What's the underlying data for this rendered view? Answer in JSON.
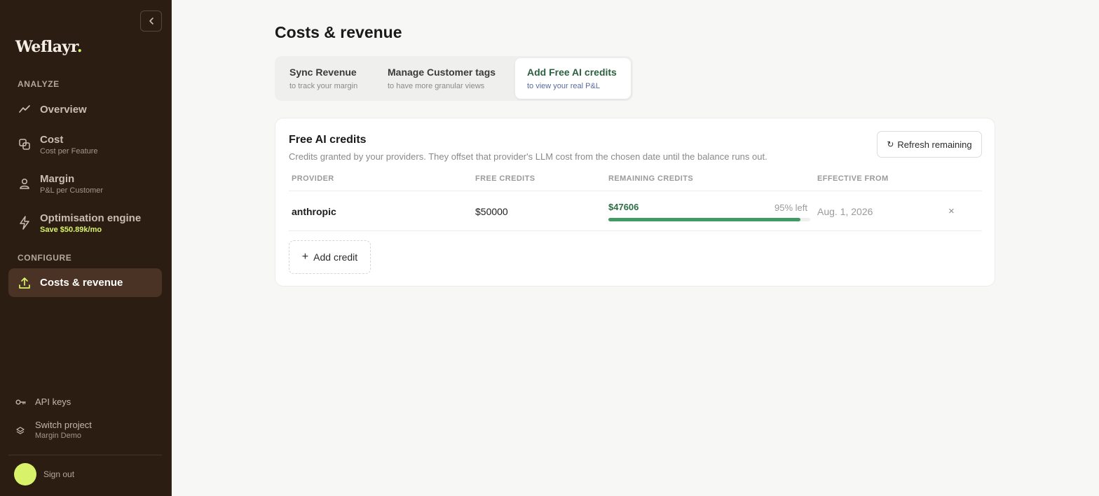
{
  "sidebar": {
    "logo_text": "Weflayr",
    "logo_dot": ".",
    "sections": {
      "analyze": "ANALYZE",
      "configure": "CONFIGURE"
    },
    "nav": {
      "overview": {
        "title": "Overview"
      },
      "cost": {
        "title": "Cost",
        "sub": "Cost per Feature"
      },
      "margin": {
        "title": "Margin",
        "sub": "P&L per Customer"
      },
      "optimisation": {
        "title": "Optimisation engine",
        "sub": "Save $50.89k/mo"
      },
      "costs_revenue": {
        "title": "Costs & revenue"
      }
    },
    "bottom": {
      "api_keys": "API keys",
      "switch_project": "Switch project",
      "project_name": "Margin Demo",
      "sign_out": "Sign out"
    },
    "colors": {
      "bg": "#2c1d12",
      "accent": "#d8f36a"
    }
  },
  "main": {
    "page_title": "Costs & revenue",
    "tabs": [
      {
        "title": "Sync Revenue",
        "sub": "to track your margin",
        "active": false
      },
      {
        "title": "Manage Customer tags",
        "sub": "to have more granular views",
        "active": false
      },
      {
        "title": "Add Free AI credits",
        "sub": "to view your real P&L",
        "active": true
      }
    ],
    "card": {
      "title": "Free AI credits",
      "description": "Credits granted by your providers. They offset that provider's LLM cost from the chosen date until the balance runs out.",
      "refresh_icon": "↻",
      "refresh_label": "Refresh remaining",
      "columns": [
        "PROVIDER",
        "FREE CREDITS",
        "REMAINING CREDITS",
        "EFFECTIVE FROM"
      ],
      "rows": [
        {
          "provider": "anthropic",
          "free_credits": "$50000",
          "remaining": "$47606",
          "remaining_pct_label": "95% left",
          "remaining_fraction": 0.95,
          "effective_from": "Aug. 1, 2026",
          "delete_icon": "×"
        }
      ],
      "add_credit_plus": "+",
      "add_credit_label": "Add credit"
    },
    "colors": {
      "green": "#3f9a63",
      "green_text": "#2c6e45"
    }
  }
}
